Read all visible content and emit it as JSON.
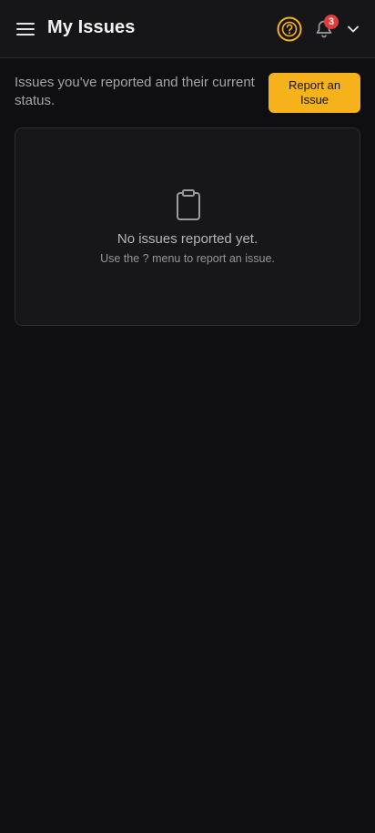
{
  "header": {
    "title": "My Issues",
    "menu_icon": "hamburger-menu-icon",
    "help_icon": "help-circle-icon",
    "notifications_icon": "bell-icon",
    "notification_count": "3",
    "account_icon": "chevron-down-icon"
  },
  "intro": {
    "description": "Issues you've reported and their current status.",
    "report_button_label": "Report an Issue"
  },
  "empty_state": {
    "icon": "clipboard-icon",
    "title": "No issues reported yet.",
    "hint": "Use the ? menu to report an issue."
  },
  "colors": {
    "accent": "#f6b21a",
    "badge": "#e23b3b",
    "background": "#0f0f12"
  }
}
